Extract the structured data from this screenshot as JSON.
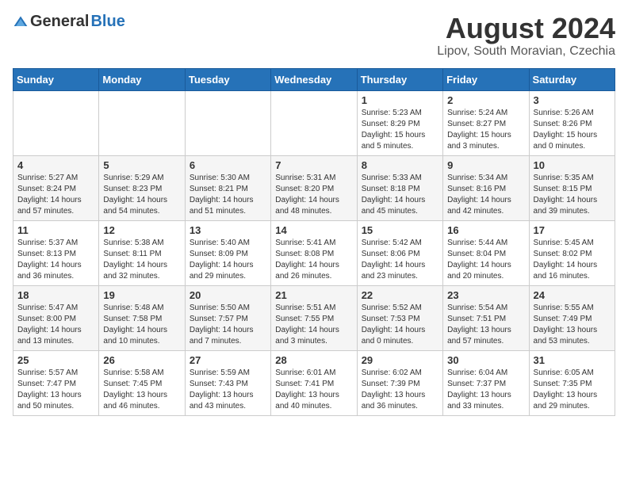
{
  "header": {
    "logo_general": "General",
    "logo_blue": "Blue",
    "month_title": "August 2024",
    "location": "Lipov, South Moravian, Czechia"
  },
  "weekdays": [
    "Sunday",
    "Monday",
    "Tuesday",
    "Wednesday",
    "Thursday",
    "Friday",
    "Saturday"
  ],
  "weeks": [
    [
      {
        "day": "",
        "info": ""
      },
      {
        "day": "",
        "info": ""
      },
      {
        "day": "",
        "info": ""
      },
      {
        "day": "",
        "info": ""
      },
      {
        "day": "1",
        "info": "Sunrise: 5:23 AM\nSunset: 8:29 PM\nDaylight: 15 hours\nand 5 minutes."
      },
      {
        "day": "2",
        "info": "Sunrise: 5:24 AM\nSunset: 8:27 PM\nDaylight: 15 hours\nand 3 minutes."
      },
      {
        "day": "3",
        "info": "Sunrise: 5:26 AM\nSunset: 8:26 PM\nDaylight: 15 hours\nand 0 minutes."
      }
    ],
    [
      {
        "day": "4",
        "info": "Sunrise: 5:27 AM\nSunset: 8:24 PM\nDaylight: 14 hours\nand 57 minutes."
      },
      {
        "day": "5",
        "info": "Sunrise: 5:29 AM\nSunset: 8:23 PM\nDaylight: 14 hours\nand 54 minutes."
      },
      {
        "day": "6",
        "info": "Sunrise: 5:30 AM\nSunset: 8:21 PM\nDaylight: 14 hours\nand 51 minutes."
      },
      {
        "day": "7",
        "info": "Sunrise: 5:31 AM\nSunset: 8:20 PM\nDaylight: 14 hours\nand 48 minutes."
      },
      {
        "day": "8",
        "info": "Sunrise: 5:33 AM\nSunset: 8:18 PM\nDaylight: 14 hours\nand 45 minutes."
      },
      {
        "day": "9",
        "info": "Sunrise: 5:34 AM\nSunset: 8:16 PM\nDaylight: 14 hours\nand 42 minutes."
      },
      {
        "day": "10",
        "info": "Sunrise: 5:35 AM\nSunset: 8:15 PM\nDaylight: 14 hours\nand 39 minutes."
      }
    ],
    [
      {
        "day": "11",
        "info": "Sunrise: 5:37 AM\nSunset: 8:13 PM\nDaylight: 14 hours\nand 36 minutes."
      },
      {
        "day": "12",
        "info": "Sunrise: 5:38 AM\nSunset: 8:11 PM\nDaylight: 14 hours\nand 32 minutes."
      },
      {
        "day": "13",
        "info": "Sunrise: 5:40 AM\nSunset: 8:09 PM\nDaylight: 14 hours\nand 29 minutes."
      },
      {
        "day": "14",
        "info": "Sunrise: 5:41 AM\nSunset: 8:08 PM\nDaylight: 14 hours\nand 26 minutes."
      },
      {
        "day": "15",
        "info": "Sunrise: 5:42 AM\nSunset: 8:06 PM\nDaylight: 14 hours\nand 23 minutes."
      },
      {
        "day": "16",
        "info": "Sunrise: 5:44 AM\nSunset: 8:04 PM\nDaylight: 14 hours\nand 20 minutes."
      },
      {
        "day": "17",
        "info": "Sunrise: 5:45 AM\nSunset: 8:02 PM\nDaylight: 14 hours\nand 16 minutes."
      }
    ],
    [
      {
        "day": "18",
        "info": "Sunrise: 5:47 AM\nSunset: 8:00 PM\nDaylight: 14 hours\nand 13 minutes."
      },
      {
        "day": "19",
        "info": "Sunrise: 5:48 AM\nSunset: 7:58 PM\nDaylight: 14 hours\nand 10 minutes."
      },
      {
        "day": "20",
        "info": "Sunrise: 5:50 AM\nSunset: 7:57 PM\nDaylight: 14 hours\nand 7 minutes."
      },
      {
        "day": "21",
        "info": "Sunrise: 5:51 AM\nSunset: 7:55 PM\nDaylight: 14 hours\nand 3 minutes."
      },
      {
        "day": "22",
        "info": "Sunrise: 5:52 AM\nSunset: 7:53 PM\nDaylight: 14 hours\nand 0 minutes."
      },
      {
        "day": "23",
        "info": "Sunrise: 5:54 AM\nSunset: 7:51 PM\nDaylight: 13 hours\nand 57 minutes."
      },
      {
        "day": "24",
        "info": "Sunrise: 5:55 AM\nSunset: 7:49 PM\nDaylight: 13 hours\nand 53 minutes."
      }
    ],
    [
      {
        "day": "25",
        "info": "Sunrise: 5:57 AM\nSunset: 7:47 PM\nDaylight: 13 hours\nand 50 minutes."
      },
      {
        "day": "26",
        "info": "Sunrise: 5:58 AM\nSunset: 7:45 PM\nDaylight: 13 hours\nand 46 minutes."
      },
      {
        "day": "27",
        "info": "Sunrise: 5:59 AM\nSunset: 7:43 PM\nDaylight: 13 hours\nand 43 minutes."
      },
      {
        "day": "28",
        "info": "Sunrise: 6:01 AM\nSunset: 7:41 PM\nDaylight: 13 hours\nand 40 minutes."
      },
      {
        "day": "29",
        "info": "Sunrise: 6:02 AM\nSunset: 7:39 PM\nDaylight: 13 hours\nand 36 minutes."
      },
      {
        "day": "30",
        "info": "Sunrise: 6:04 AM\nSunset: 7:37 PM\nDaylight: 13 hours\nand 33 minutes."
      },
      {
        "day": "31",
        "info": "Sunrise: 6:05 AM\nSunset: 7:35 PM\nDaylight: 13 hours\nand 29 minutes."
      }
    ]
  ]
}
